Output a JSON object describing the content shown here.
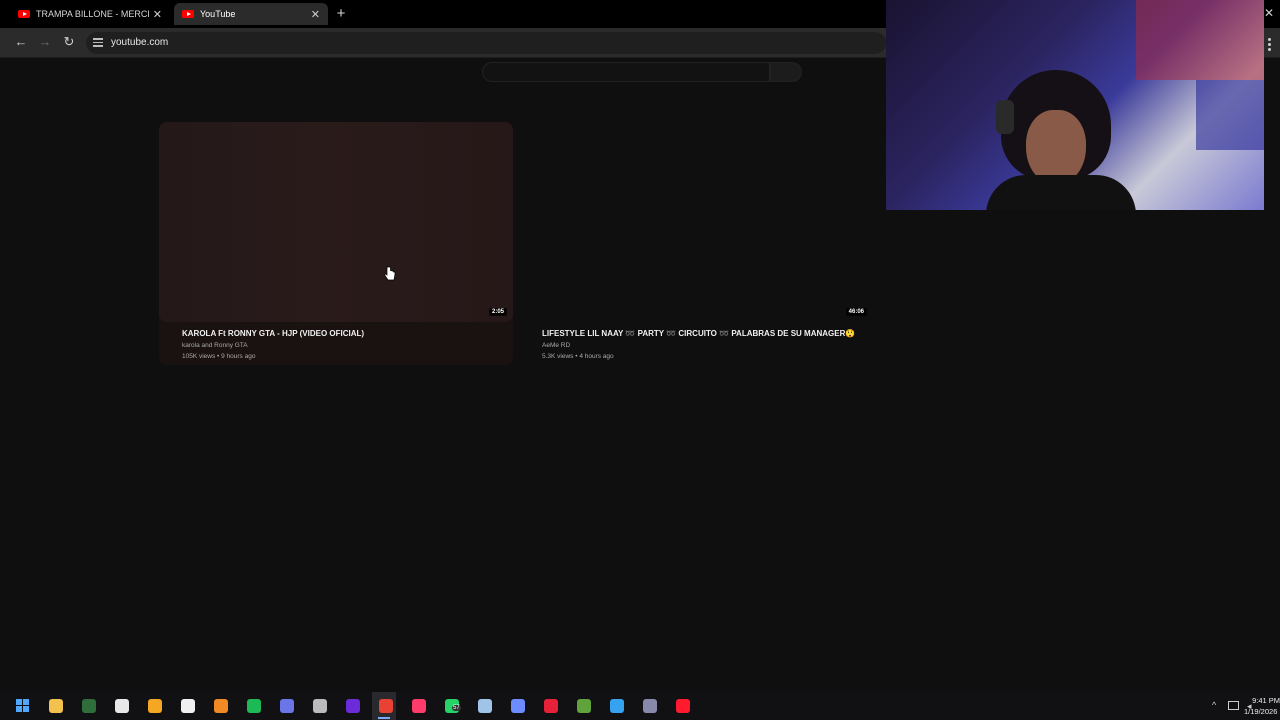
{
  "browser": {
    "tabs": [
      {
        "title": "TRAMPA BILLONE - MERCEDES",
        "active": false
      },
      {
        "title": "YouTube",
        "active": true
      }
    ],
    "new_tab": "+",
    "close_glyph": "✕",
    "nav": {
      "back": "←",
      "forward": "→",
      "reload": "↻"
    },
    "url": "youtube.com"
  },
  "page": {
    "videos": [
      {
        "title": "KAROLA Ft RONNY  GTA  -  HJP  (VIDEO OFICIAL)",
        "channel": "karola and Ronny GTA",
        "meta": "105K views • 9 hours ago",
        "duration": "2:05",
        "hovered": true
      },
      {
        "title": "LIFESTYLE LIL NAAY ➿ PARTY ➿ CIRCUITO ➿ PALABRAS DE SU MANAGER😲",
        "channel": "AeMe RD",
        "meta": "5.3K views • 4 hours ago",
        "duration": "46:06",
        "hovered": false
      }
    ]
  },
  "taskbar": {
    "icons": [
      {
        "name": "file-explorer-icon",
        "color": "#f2c14e"
      },
      {
        "name": "terminal-icon",
        "color": "#2f6e3a"
      },
      {
        "name": "obs-icon",
        "color": "#e8e8e8"
      },
      {
        "name": "app-orange-icon",
        "color": "#f5a623"
      },
      {
        "name": "capcut-icon",
        "color": "#f0f0f0"
      },
      {
        "name": "fl-studio-icon",
        "color": "#f08a24"
      },
      {
        "name": "spotify-icon",
        "color": "#1db954"
      },
      {
        "name": "discord-icon",
        "color": "#6a76e8"
      },
      {
        "name": "speedtest-icon",
        "color": "#bbbbbb"
      },
      {
        "name": "nzxt-icon",
        "color": "#6b2bd9"
      },
      {
        "name": "chrome-icon",
        "color": "#e94235"
      },
      {
        "name": "tiktok-icon",
        "color": "#ff3b6b"
      },
      {
        "name": "whatsapp-icon",
        "color": "#25d366"
      },
      {
        "name": "steam-icon",
        "color": "#9fc4e8"
      },
      {
        "name": "4k-downloader-icon",
        "color": "#6c8cff"
      },
      {
        "name": "app-red-icon",
        "color": "#e8213b"
      },
      {
        "name": "minecraft-icon",
        "color": "#5fa33a"
      },
      {
        "name": "app-blue-icon",
        "color": "#36a3f0"
      },
      {
        "name": "app-grid-icon",
        "color": "#8888aa"
      },
      {
        "name": "opera-icon",
        "color": "#ff1b2d"
      }
    ],
    "whatsapp_badge": "57",
    "clock": {
      "time": "9:41 PM",
      "date": "1/19/2026"
    }
  }
}
